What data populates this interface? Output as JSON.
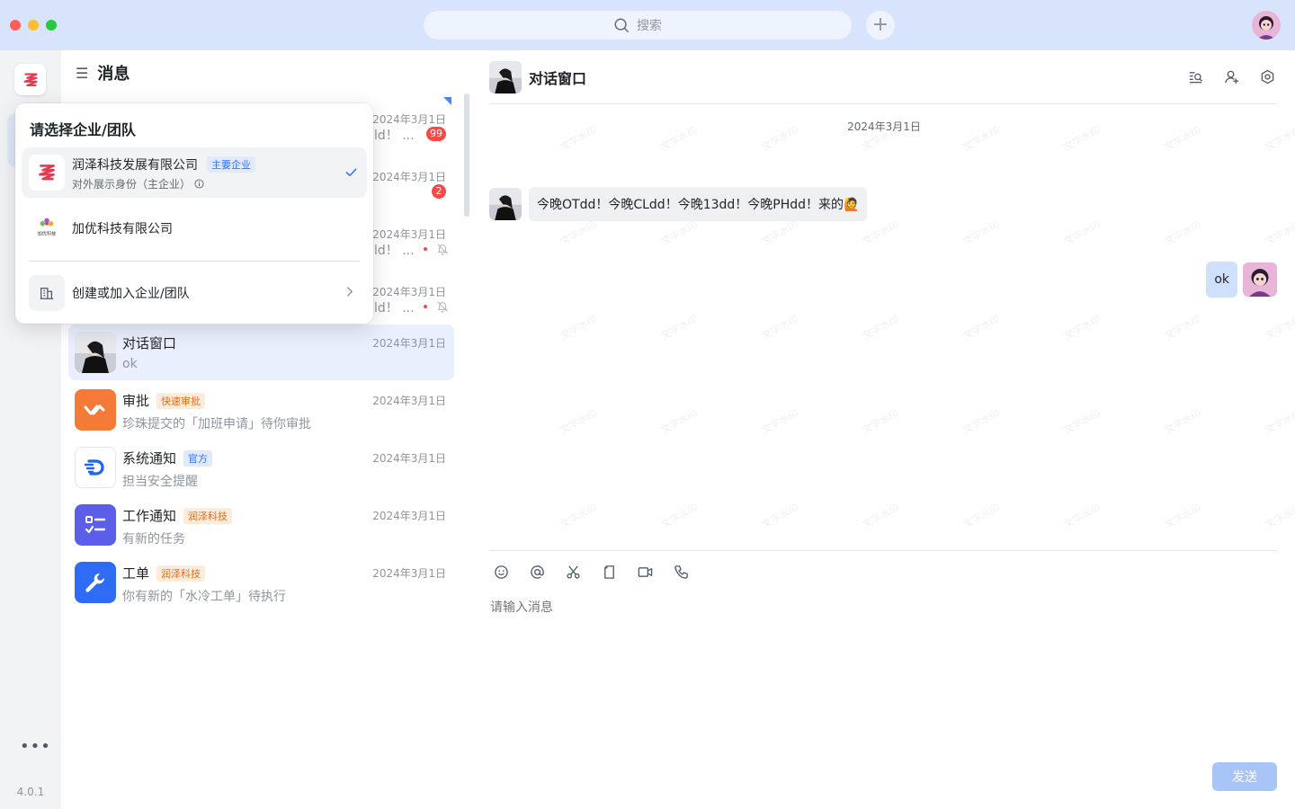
{
  "titlebar": {
    "search_placeholder": "搜索"
  },
  "rail": {
    "more": "•••",
    "version": "4.0.1"
  },
  "list": {
    "title": "消息",
    "hidden_items": [
      {
        "time": "2024年3月1日",
        "preview_tail": "ld！ ...",
        "badge": "99"
      },
      {
        "time": "2024年3月1日",
        "preview_tail": "",
        "badge": "2"
      },
      {
        "time": "2024年3月1日",
        "preview_tail": "ld！ ...",
        "muted": true
      },
      {
        "time": "2024年3月1日",
        "preview_tail": "ld！ ...",
        "muted": true
      }
    ],
    "items": [
      {
        "name": "对话窗口",
        "tag": "",
        "preview": "ok",
        "time": "2024年3月1日",
        "active": true
      },
      {
        "name": "审批",
        "tag": "快速审批",
        "preview": "珍珠提交的「加班申请」待你审批",
        "time": "2024年3月1日"
      },
      {
        "name": "系统通知",
        "tag": "官方",
        "preview": "担当安全提醒",
        "time": "2024年3月1日"
      },
      {
        "name": "工作通知",
        "tag": "润泽科技",
        "preview": "有新的任务",
        "time": "2024年3月1日"
      },
      {
        "name": "工单",
        "tag": "润泽科技",
        "preview": "你有新的「水冷工单」待执行",
        "time": "2024年3月1日"
      }
    ]
  },
  "org_dropdown": {
    "title": "请选择企业/团队",
    "orgs": [
      {
        "name": "润泽科技发展有限公司",
        "tag": "主要企业",
        "sub": "对外展示身份（主企业）",
        "selected": true
      },
      {
        "name": "加优科技有限公司",
        "logo_text": "加优科技"
      }
    ],
    "create_join": "创建或加入企业/团队"
  },
  "chat": {
    "title": "对话窗口",
    "date": "2024年3月1日",
    "watermark": "文字水印",
    "messages": [
      {
        "from": "other",
        "text": "今晚OTdd！今晚CLdd！今晚13dd！今晚PHdd！来的🙋"
      },
      {
        "from": "me",
        "text": "ok"
      }
    ],
    "input_placeholder": "请输入消息",
    "send_label": "发送"
  },
  "colors": {
    "accent": "#3370ff",
    "titlebar_bg": "#d8e4fb",
    "active_row_bg": "#e9effd",
    "badge_red": "#f54a45",
    "send_disabled": "#a9c4f7"
  },
  "icons": {
    "search": "search-icon",
    "plus": "plus-icon",
    "menu": "menu-icon",
    "check": "check-icon",
    "chevron": "chevron-right-icon",
    "chat_search": "chat-search-icon",
    "add_member": "add-member-icon",
    "settings": "gear-icon",
    "emoji": "emoji-icon",
    "mention": "at-icon",
    "screenshot": "scissors-icon",
    "file": "file-icon",
    "video": "video-icon",
    "phone": "phone-icon"
  }
}
